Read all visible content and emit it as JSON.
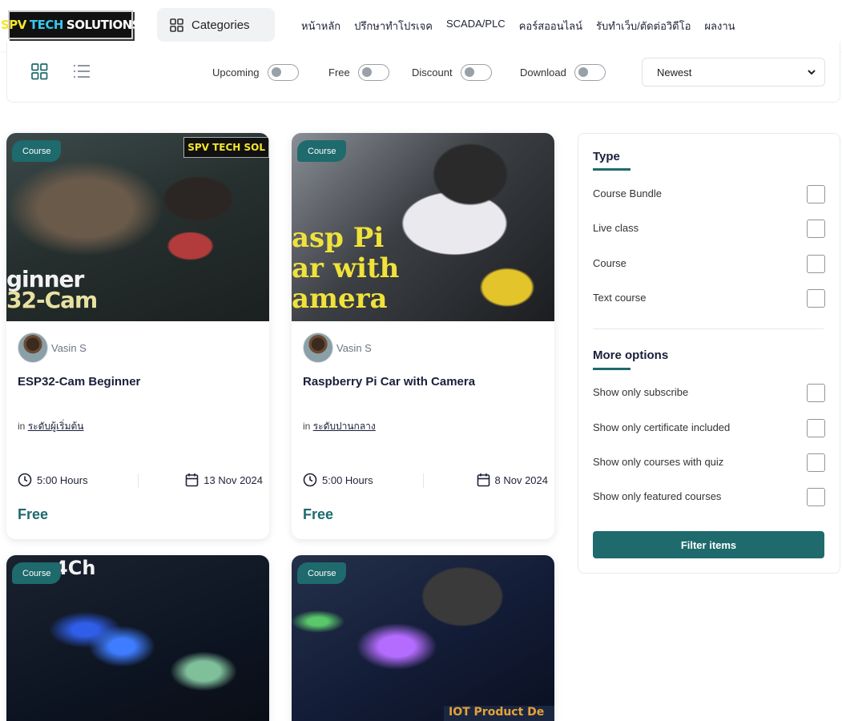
{
  "header": {
    "logo": {
      "part1": "SPV",
      "part2": "TECH",
      "part3": "SOLUTIONS",
      "colors": {
        "spv": "#f5e52b",
        "tech": "#3ac6ee"
      }
    },
    "categories_label": "Categories",
    "nav": [
      "หน้าหลัก",
      "ปรึกษาทำโปรเจค",
      "SCADA/PLC",
      "คอร์สออนไลน์",
      "รับทำเว็บ/ตัดต่อวิดีโอ",
      "ผลงาน"
    ]
  },
  "filters": {
    "toggles": [
      {
        "label": "Upcoming",
        "on": false
      },
      {
        "label": "Free",
        "on": false
      },
      {
        "label": "Discount",
        "on": false
      },
      {
        "label": "Download",
        "on": false
      }
    ],
    "sort": {
      "selected": "Newest"
    },
    "view": {
      "grid_icon": "grid-icon",
      "list_icon": "list-icon"
    }
  },
  "courses": [
    {
      "badge": "Course",
      "thumb_text": [
        "ginner",
        "32-Cam"
      ],
      "thumb_logo": "SPV TECH SOL",
      "author": "Vasin S",
      "title": "ESP32-Cam Beginner",
      "level_prefix": "in",
      "level": "ระดับผู้เริ่มต้น",
      "hours": "5:00 Hours",
      "date": "13 Nov 2024",
      "price": "Free"
    },
    {
      "badge": "Course",
      "thumb_text": [
        "asp Pi",
        "ar with",
        "amera"
      ],
      "author": "Vasin S",
      "title": "Raspberry Pi Car with Camera",
      "level_prefix": "in",
      "level": "ระดับปานกลาง",
      "hours": "5:00 Hours",
      "date": "8 Nov 2024",
      "price": "Free"
    },
    {
      "badge": "Course",
      "thumb_text": [
        "4Ch"
      ]
    },
    {
      "badge": "Course",
      "thumb_text": [
        "IOT Product De"
      ]
    }
  ],
  "sidebar": {
    "type_title": "Type",
    "type_options": [
      "Course Bundle",
      "Live class",
      "Course",
      "Text course"
    ],
    "more_title": "More options",
    "more_options": [
      "Show only subscribe",
      "Show only certificate included",
      "Show only courses with quiz",
      "Show only featured courses"
    ],
    "filter_button": "Filter items"
  },
  "colors": {
    "accent": "#1e6a6d",
    "text_dark": "#1a1f3a"
  }
}
